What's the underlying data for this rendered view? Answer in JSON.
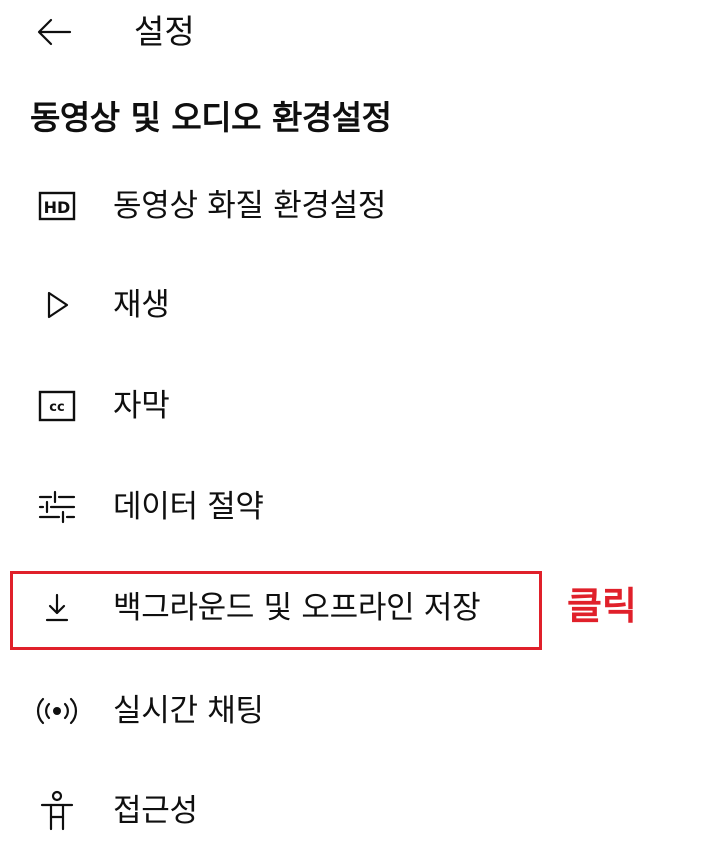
{
  "header": {
    "title": "설정",
    "back_icon": "arrow-left-icon"
  },
  "section": {
    "title": "동영상 및 오디오 환경설정"
  },
  "menu": {
    "items": [
      {
        "label": "동영상 화질 환경설정",
        "icon": "hd-icon"
      },
      {
        "label": "재생",
        "icon": "play-outline-icon"
      },
      {
        "label": "자막",
        "icon": "closed-captions-icon"
      },
      {
        "label": "데이터 절약",
        "icon": "sliders-icon"
      },
      {
        "label": "백그라운드 및 오프라인 저장",
        "icon": "download-icon"
      },
      {
        "label": "실시간 채팅",
        "icon": "live-broadcast-icon"
      },
      {
        "label": "접근성",
        "icon": "accessibility-icon"
      }
    ]
  },
  "annotation": {
    "text": "클릭",
    "color": "#e0202a"
  }
}
